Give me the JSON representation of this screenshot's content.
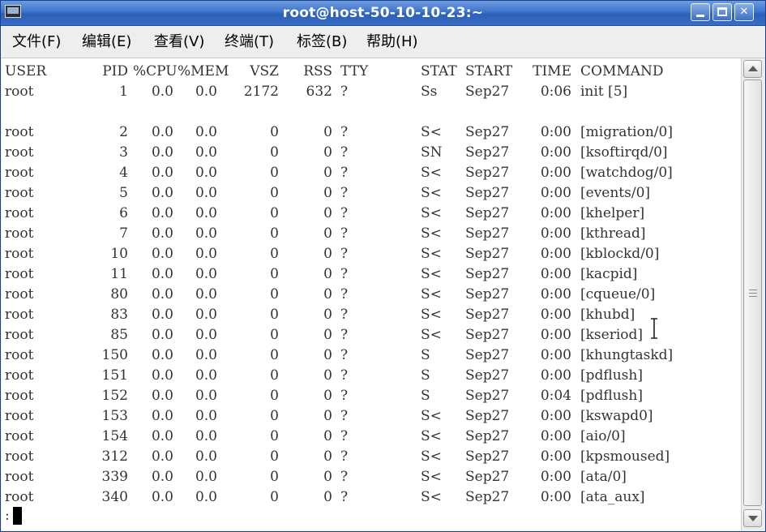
{
  "window": {
    "title": "root@host-50-10-10-23:~",
    "min_glyph": "",
    "max_glyph": "",
    "close_glyph": "✕"
  },
  "menu": [
    {
      "label": "文件(F)"
    },
    {
      "label": "编辑(E)"
    },
    {
      "label": "查看(V)"
    },
    {
      "label": "终端(T)"
    },
    {
      "label": "标签(B)"
    },
    {
      "label": "帮助(H)"
    }
  ],
  "terminal": {
    "headers": [
      "USER",
      "PID",
      "%CPU",
      "%MEM",
      "VSZ",
      "RSS",
      "TTY",
      "STAT",
      "START",
      "TIME",
      "COMMAND"
    ],
    "rows": [
      [
        "root",
        "1",
        "0.0",
        "0.0",
        "2172",
        "632",
        "?",
        "Ss",
        "Sep27",
        "0:06",
        "init [5]"
      ],
      [
        "root",
        "2",
        "0.0",
        "0.0",
        "0",
        "0",
        "?",
        "S<",
        "Sep27",
        "0:00",
        "[migration/0]"
      ],
      [
        "root",
        "3",
        "0.0",
        "0.0",
        "0",
        "0",
        "?",
        "SN",
        "Sep27",
        "0:00",
        "[ksoftirqd/0]"
      ],
      [
        "root",
        "4",
        "0.0",
        "0.0",
        "0",
        "0",
        "?",
        "S<",
        "Sep27",
        "0:00",
        "[watchdog/0]"
      ],
      [
        "root",
        "5",
        "0.0",
        "0.0",
        "0",
        "0",
        "?",
        "S<",
        "Sep27",
        "0:00",
        "[events/0]"
      ],
      [
        "root",
        "6",
        "0.0",
        "0.0",
        "0",
        "0",
        "?",
        "S<",
        "Sep27",
        "0:00",
        "[khelper]"
      ],
      [
        "root",
        "7",
        "0.0",
        "0.0",
        "0",
        "0",
        "?",
        "S<",
        "Sep27",
        "0:00",
        "[kthread]"
      ],
      [
        "root",
        "10",
        "0.0",
        "0.0",
        "0",
        "0",
        "?",
        "S<",
        "Sep27",
        "0:00",
        "[kblockd/0]"
      ],
      [
        "root",
        "11",
        "0.0",
        "0.0",
        "0",
        "0",
        "?",
        "S<",
        "Sep27",
        "0:00",
        "[kacpid]"
      ],
      [
        "root",
        "80",
        "0.0",
        "0.0",
        "0",
        "0",
        "?",
        "S<",
        "Sep27",
        "0:00",
        "[cqueue/0]"
      ],
      [
        "root",
        "83",
        "0.0",
        "0.0",
        "0",
        "0",
        "?",
        "S<",
        "Sep27",
        "0:00",
        "[khubd]"
      ],
      [
        "root",
        "85",
        "0.0",
        "0.0",
        "0",
        "0",
        "?",
        "S<",
        "Sep27",
        "0:00",
        "[kseriod]"
      ],
      [
        "root",
        "150",
        "0.0",
        "0.0",
        "0",
        "0",
        "?",
        "S",
        "Sep27",
        "0:00",
        "[khungtaskd]"
      ],
      [
        "root",
        "151",
        "0.0",
        "0.0",
        "0",
        "0",
        "?",
        "S",
        "Sep27",
        "0:00",
        "[pdflush]"
      ],
      [
        "root",
        "152",
        "0.0",
        "0.0",
        "0",
        "0",
        "?",
        "S",
        "Sep27",
        "0:04",
        "[pdflush]"
      ],
      [
        "root",
        "153",
        "0.0",
        "0.0",
        "0",
        "0",
        "?",
        "S<",
        "Sep27",
        "0:00",
        "[kswapd0]"
      ],
      [
        "root",
        "154",
        "0.0",
        "0.0",
        "0",
        "0",
        "?",
        "S<",
        "Sep27",
        "0:00",
        "[aio/0]"
      ],
      [
        "root",
        "312",
        "0.0",
        "0.0",
        "0",
        "0",
        "?",
        "S<",
        "Sep27",
        "0:00",
        "[kpsmoused]"
      ],
      [
        "root",
        "339",
        "0.0",
        "0.0",
        "0",
        "0",
        "?",
        "S<",
        "Sep27",
        "0:00",
        "[ata/0]"
      ],
      [
        "root",
        "340",
        "0.0",
        "0.0",
        "0",
        "0",
        "?",
        "S<",
        "Sep27",
        "0:00",
        "[ata_aux]"
      ]
    ],
    "prompt": ":"
  },
  "icons": {
    "app": "terminal-icon",
    "minimize": "minimize-icon",
    "maximize": "maximize-icon",
    "close": "close-icon",
    "scroll_up": "arrow-up-icon",
    "scroll_down": "arrow-down-icon",
    "cursor": "text-cursor-icon"
  },
  "colors": {
    "titlebar": "#3e74cc",
    "terminal_bg": "#ffffff",
    "terminal_text": "#333333"
  }
}
